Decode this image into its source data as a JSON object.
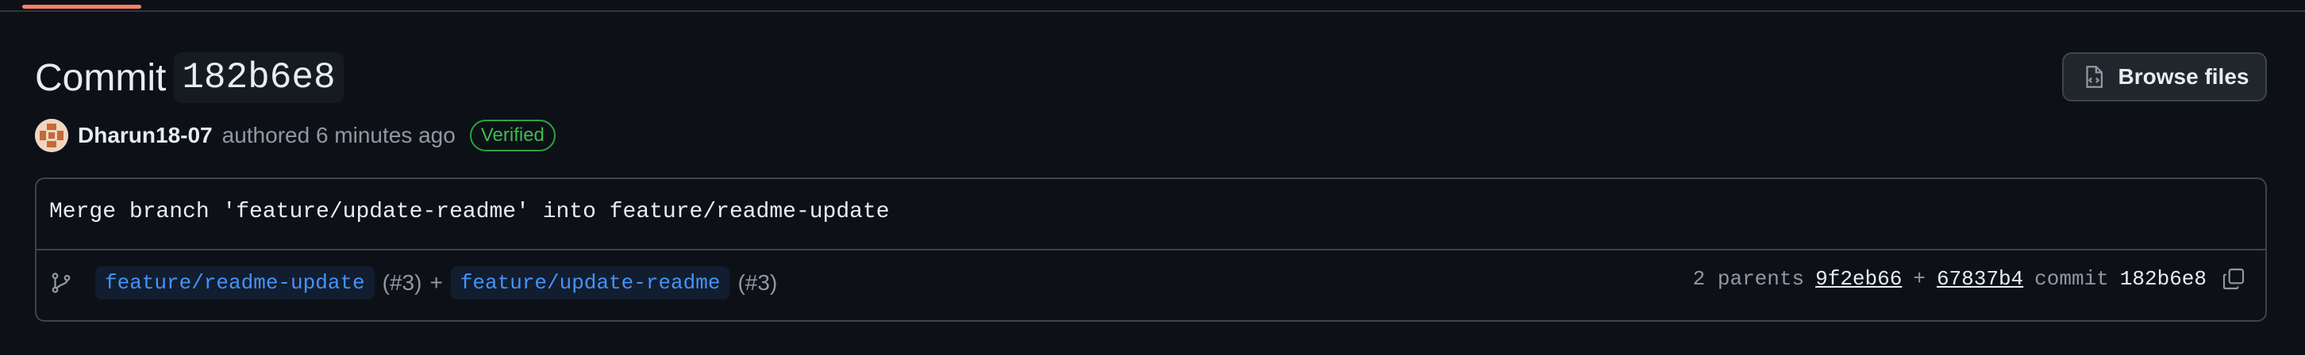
{
  "header": {
    "title_word": "Commit",
    "title_sha": "182b6e8",
    "browse_label": "Browse files"
  },
  "meta": {
    "author": "Dharun18-07",
    "authored_text": "authored 6 minutes ago",
    "verified_label": "Verified"
  },
  "commit_message": "Merge branch 'feature/update-readme' into feature/readme-update",
  "branches": {
    "items": [
      {
        "name": "feature/readme-update",
        "pr": "(#3)"
      },
      {
        "name": "feature/update-readme",
        "pr": "(#3)"
      }
    ],
    "separator": "+"
  },
  "parents": {
    "label": "2 parents",
    "first": "9f2eb66",
    "separator": "+",
    "second": "67837b4",
    "commit_label": "commit",
    "commit_sha": "182b6e8"
  },
  "colors": {
    "background": "#0d1117",
    "accent_tab": "#f78166",
    "link_blue": "#4493f8",
    "verified_green": "#3fb950"
  }
}
